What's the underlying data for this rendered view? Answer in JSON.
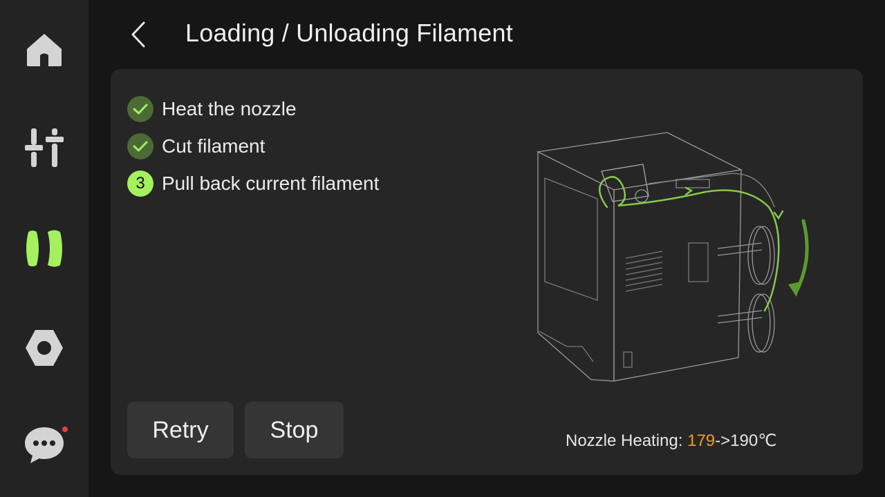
{
  "header": {
    "title": "Loading / Unloading Filament"
  },
  "sidebar": {
    "items": [
      {
        "icon": "home-icon",
        "active": false
      },
      {
        "icon": "sliders-icon",
        "active": false
      },
      {
        "icon": "filament-spool-icon",
        "active": true
      },
      {
        "icon": "settings-hex-icon",
        "active": false
      },
      {
        "icon": "chat-icon",
        "active": false,
        "notification": true
      }
    ]
  },
  "steps": [
    {
      "label": "Heat the nozzle",
      "status": "done"
    },
    {
      "label": "Cut filament",
      "status": "done"
    },
    {
      "label": "Pull back current filament",
      "status": "active",
      "number": "3"
    }
  ],
  "buttons": {
    "retry": "Retry",
    "stop": "Stop"
  },
  "nozzle": {
    "label": "Nozzle Heating:",
    "current": "179",
    "arrow": "->",
    "target": "190℃"
  },
  "colors": {
    "accent": "#a4f05e",
    "done_badge": "#4c6a36",
    "current_temp": "#f39a2c",
    "notification": "#e84040"
  }
}
